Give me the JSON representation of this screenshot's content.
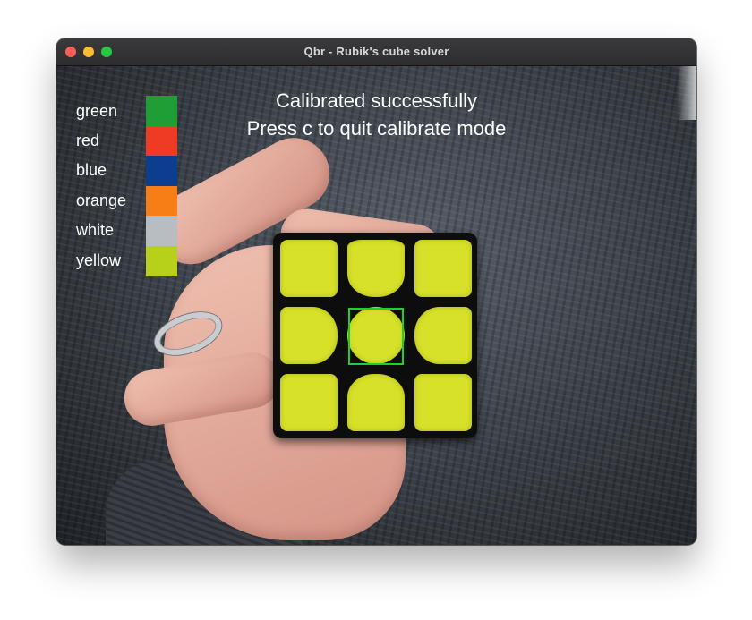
{
  "window": {
    "title": "Qbr - Rubik's cube solver"
  },
  "overlay": {
    "status_line_1": "Calibrated successfully",
    "status_line_2": "Press c to quit calibrate mode",
    "detection_color": "#1cd12d"
  },
  "legend": [
    {
      "label": "green",
      "color": "#1f9e34"
    },
    {
      "label": "red",
      "color": "#ef3b23"
    },
    {
      "label": "blue",
      "color": "#0c3e8f"
    },
    {
      "label": "orange",
      "color": "#f77d16"
    },
    {
      "label": "white",
      "color": "#b8bdc1"
    },
    {
      "label": "yellow",
      "color": "#b7d11a"
    }
  ],
  "cube": {
    "face_colors": [
      [
        "yellow",
        "yellow",
        "yellow"
      ],
      [
        "yellow",
        "yellow",
        "yellow"
      ],
      [
        "yellow",
        "yellow",
        "yellow"
      ]
    ],
    "sticker_color": "#d7e12a"
  },
  "icons": {
    "close": "close-traffic-light-icon",
    "minimize": "minimize-traffic-light-icon",
    "zoom": "zoom-traffic-light-icon"
  }
}
